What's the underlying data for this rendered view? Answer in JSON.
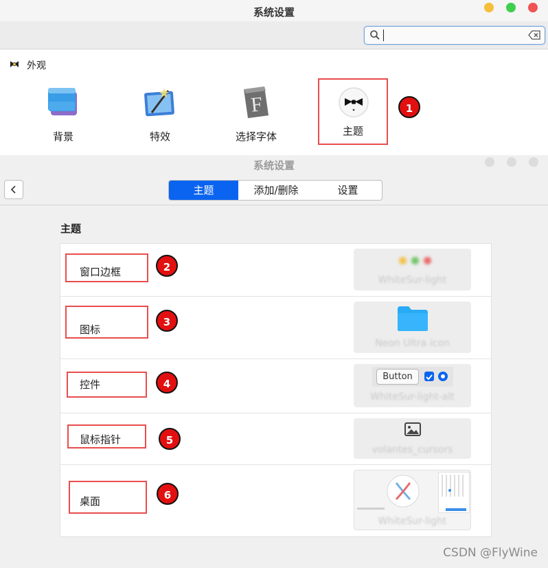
{
  "top_window": {
    "title": "系统设置",
    "search": {
      "value": "",
      "placeholder": ""
    },
    "section_label": "外观",
    "items": [
      {
        "label": "背景",
        "icon": "background-icon"
      },
      {
        "label": "特效",
        "icon": "effects-icon"
      },
      {
        "label": "选择字体",
        "icon": "font-icon"
      },
      {
        "label": "主题",
        "icon": "theme-bowtie-icon",
        "selected": true
      }
    ]
  },
  "theme_window": {
    "title": "系统设置",
    "tabs": [
      {
        "label": "主题",
        "active": true
      },
      {
        "label": "添加/删除",
        "active": false
      },
      {
        "label": "设置",
        "active": false
      }
    ],
    "heading": "主题",
    "rows": [
      {
        "label": "窗口边框",
        "preview_name": "WhiteSur-light"
      },
      {
        "label": "图标",
        "preview_name": "Neon Ultra icon"
      },
      {
        "label": "控件",
        "preview_name": "WhiteSur-light-alt",
        "preview_button": "Button"
      },
      {
        "label": "鼠标指针",
        "preview_name": "volantes_cursors"
      },
      {
        "label": "桌面",
        "preview_name": "WhiteSur-light"
      }
    ]
  },
  "annotations": [
    "1",
    "2",
    "3",
    "4",
    "5",
    "6"
  ],
  "watermark": "CSDN @FlyWine",
  "colors": {
    "accent": "#0a64f0",
    "highlight": "#e94c4c",
    "badge": "#e21010",
    "folder": "#29aaf5"
  }
}
